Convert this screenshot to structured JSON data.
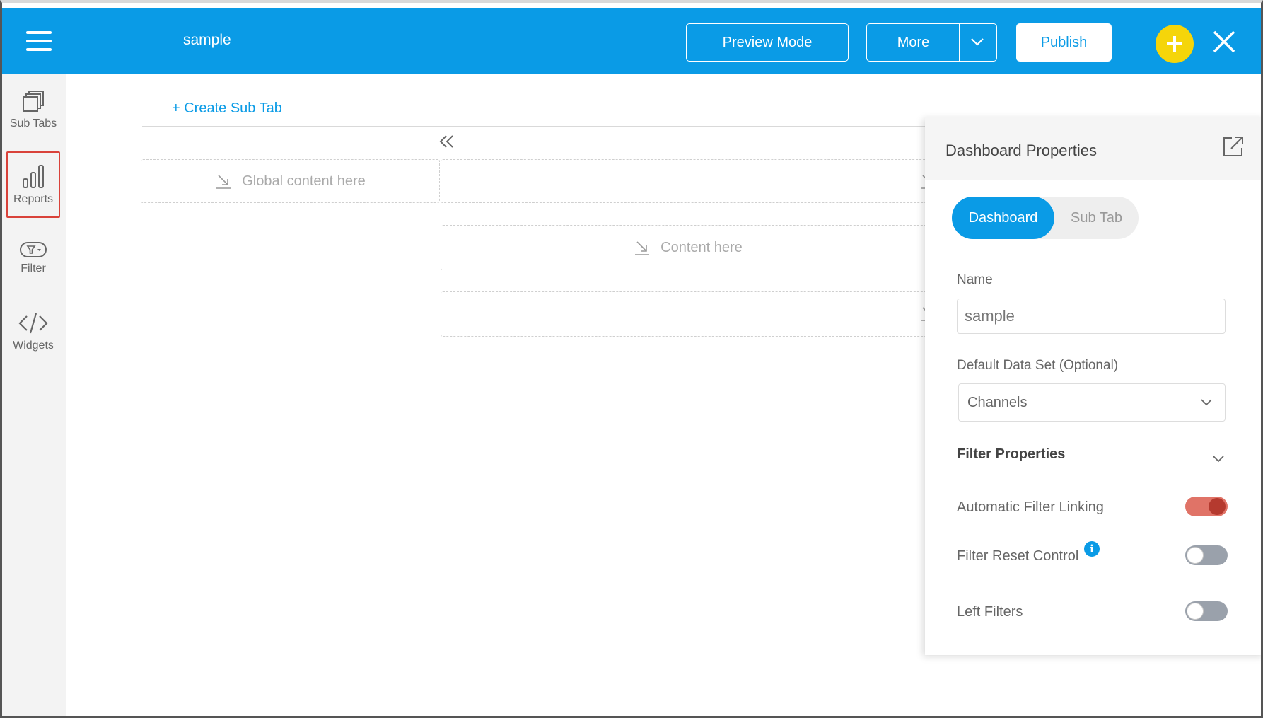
{
  "header": {
    "title": "sample",
    "preview_label": "Preview Mode",
    "more_label": "More",
    "publish_label": "Publish",
    "icons": [
      "hamburger-menu-icon",
      "chevron-down-icon",
      "plus-icon",
      "close-icon"
    ],
    "colors": {
      "bar": "#0a9be6",
      "plus": "#f5d50a"
    }
  },
  "sidebar": {
    "items": [
      {
        "label": "Sub Tabs",
        "icon": "stacked-pages-icon"
      },
      {
        "label": "Reports",
        "icon": "bar-chart-icon",
        "active": true
      },
      {
        "label": "Filter",
        "icon": "filter-icon"
      },
      {
        "label": "Widgets",
        "icon": "code-icon"
      }
    ]
  },
  "main": {
    "create_subtab": "+ Create Sub Tab",
    "zones": {
      "global": "Global content here",
      "content": "Content here"
    }
  },
  "panel": {
    "title": "Dashboard Properties",
    "segments": [
      "Dashboard",
      "Sub Tab"
    ],
    "name_label": "Name",
    "name_value": "sample",
    "dataset_label": "Default Data Set (Optional)",
    "dataset_value": "Channels",
    "filter_props_label": "Filter Properties",
    "toggles": [
      {
        "label": "Automatic Filter Linking",
        "on": true
      },
      {
        "label": "Filter Reset Control",
        "on": false
      },
      {
        "label": "Left Filters",
        "on": false
      }
    ],
    "info_glyph": "i"
  }
}
